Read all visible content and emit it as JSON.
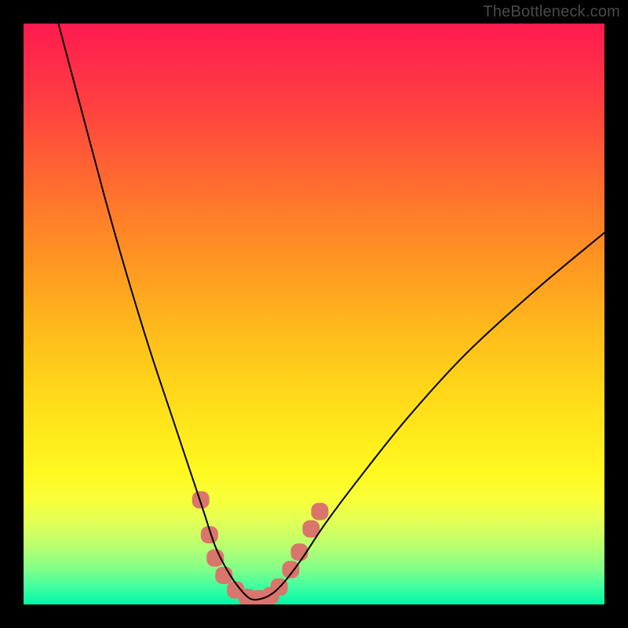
{
  "watermark": "TheBottleneck.com",
  "chart_data": {
    "type": "line",
    "title": "",
    "xlabel": "",
    "ylabel": "",
    "xlim": [
      0,
      100
    ],
    "ylim": [
      0,
      100
    ],
    "legend": false,
    "grid": false,
    "background_gradient": {
      "direction": "vertical",
      "stops": [
        {
          "pos": 0.0,
          "color": "#ff1a4f"
        },
        {
          "pos": 0.5,
          "color": "#ffc31c"
        },
        {
          "pos": 0.8,
          "color": "#fff820"
        },
        {
          "pos": 1.0,
          "color": "#00f7a8"
        }
      ]
    },
    "series": [
      {
        "name": "bottleneck-curve",
        "color": "#000000",
        "x": [
          6,
          10,
          14,
          18,
          22,
          26,
          29,
          31,
          33,
          35,
          37,
          39,
          41,
          43,
          45,
          48,
          52,
          58,
          66,
          76,
          88,
          100
        ],
        "y": [
          100,
          85,
          70,
          56,
          43,
          31,
          22,
          16,
          10,
          6,
          3,
          1,
          1,
          2,
          4,
          8,
          14,
          22,
          32,
          43,
          54,
          64
        ]
      }
    ],
    "markers": {
      "name": "highlighted-points",
      "color": "#d9756b",
      "shape": "rounded-square",
      "points": [
        {
          "x": 30.5,
          "y": 18
        },
        {
          "x": 32.0,
          "y": 12
        },
        {
          "x": 33.0,
          "y": 8
        },
        {
          "x": 34.5,
          "y": 5
        },
        {
          "x": 36.5,
          "y": 2.5
        },
        {
          "x": 38.5,
          "y": 1.2
        },
        {
          "x": 40.5,
          "y": 1.0
        },
        {
          "x": 42.5,
          "y": 1.5
        },
        {
          "x": 44.0,
          "y": 3.0
        },
        {
          "x": 46.0,
          "y": 6.0
        },
        {
          "x": 47.5,
          "y": 9.0
        },
        {
          "x": 49.5,
          "y": 13.0
        },
        {
          "x": 51.0,
          "y": 16.0
        }
      ]
    }
  }
}
